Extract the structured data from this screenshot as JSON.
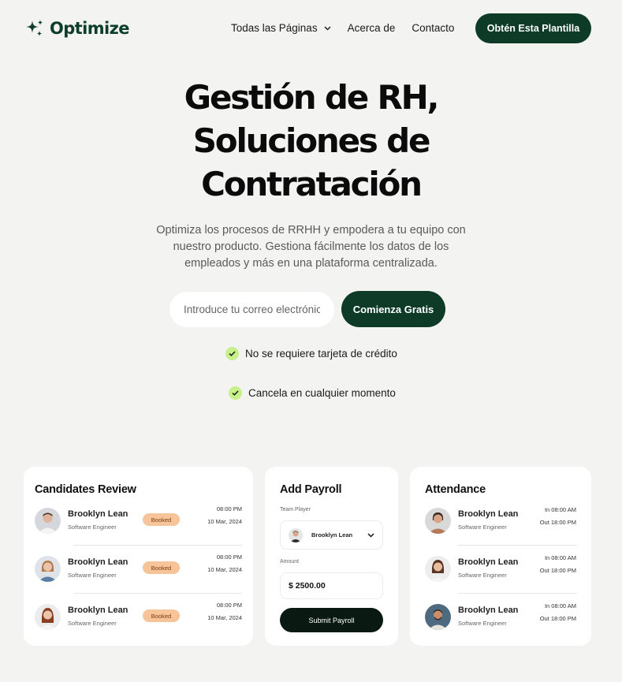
{
  "brand": {
    "name": "Optimize"
  },
  "nav": {
    "links": [
      {
        "label": "Todas las Páginas"
      },
      {
        "label": "Acerca de"
      },
      {
        "label": "Contacto"
      }
    ],
    "cta": "Obtén Esta Plantilla"
  },
  "hero": {
    "title_lines": [
      "Gestión de RH,",
      "Soluciones de",
      "Contratación"
    ],
    "subtitle_lines": [
      "Optimiza los procesos de RRHH y empodera a tu equipo con",
      "nuestro producto. Gestiona fácilmente los datos de los",
      "empleados y más en una plataforma centralizada."
    ],
    "email_placeholder": "Introduce tu correo electrónico",
    "cta": "Comienza Gratis",
    "checks": [
      "No se requiere tarjeta de crédito",
      "Cancela en cualquier momento"
    ]
  },
  "candidates": {
    "title": "Candidates Review",
    "rows": [
      {
        "name": "Brooklyn Lean",
        "role": "Software Engineer",
        "status": "Booked",
        "time": "08:00 PM",
        "date": "10 Mar, 2024"
      },
      {
        "name": "Brooklyn Lean",
        "role": "Software Engineer",
        "status": "Booked",
        "time": "08:00 PM",
        "date": "10 Mar, 2024"
      },
      {
        "name": "Brooklyn Lean",
        "role": "Software Engineer",
        "status": "Booked",
        "time": "08:00 PM",
        "date": "10 Mar, 2024"
      }
    ]
  },
  "payroll": {
    "title": "Add Payroll",
    "team_label": "Team Player",
    "team_value": "Brooklyn Lean",
    "amount_label": "Amount",
    "amount_value": "$ 2500.00",
    "submit": "Submit Payroll"
  },
  "attendance": {
    "title": "Attendance",
    "rows": [
      {
        "name": "Brooklyn Lean",
        "role": "Software Engineer",
        "in": "In 08:00 AM",
        "out": "Out 18:00 PM"
      },
      {
        "name": "Brooklyn Lean",
        "role": "Software Engineer",
        "in": "In 08:00 AM",
        "out": "Out 18:00 PM"
      },
      {
        "name": "Brooklyn Lean",
        "role": "Software Engineer",
        "in": "In 08:00 AM",
        "out": "Out 18:00 PM"
      }
    ]
  },
  "colors": {
    "brand_dark": "#0d3b27",
    "check_bg": "#c7f08a",
    "badge_bg": "#f7c399",
    "page_bg": "#f3f3f1"
  },
  "icons": [
    "sparkle-logo-icon",
    "chevron-down-icon",
    "check-icon",
    "avatar"
  ]
}
